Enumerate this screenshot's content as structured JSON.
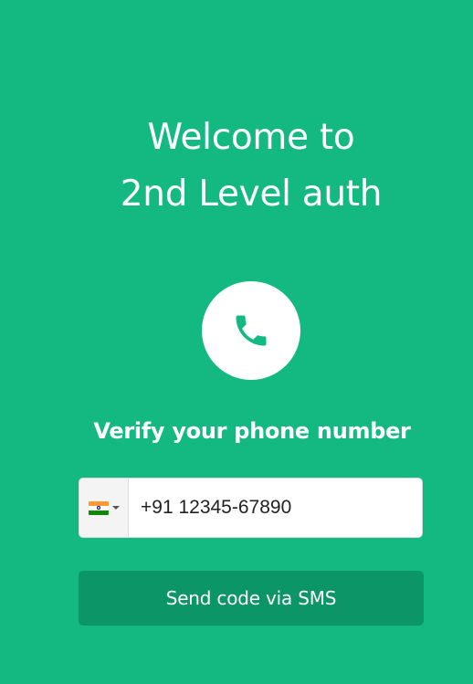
{
  "heading": {
    "line1": "Welcome to",
    "line2": "2nd Level auth"
  },
  "icon": {
    "name": "phone-icon",
    "color": "#13b981"
  },
  "subheading": "Verify your phone number",
  "phone_input": {
    "country_flag": "india-flag-icon",
    "value": "+91 12345-67890"
  },
  "send_button": {
    "label": "Send code via SMS"
  },
  "colors": {
    "background": "#13b981",
    "button": "#0c9567"
  }
}
